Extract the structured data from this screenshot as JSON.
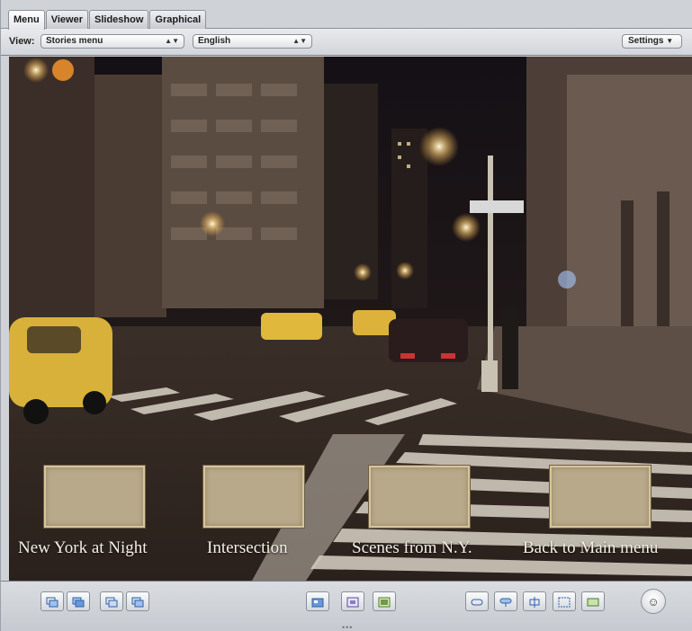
{
  "tabs": [
    {
      "label": "Menu",
      "active": true
    },
    {
      "label": "Viewer",
      "active": false
    },
    {
      "label": "Slideshow",
      "active": false
    },
    {
      "label": "Graphical",
      "active": false
    }
  ],
  "toolbar": {
    "view_label": "View:",
    "view_select": "Stories menu",
    "language_select": "English",
    "settings_label": "Settings"
  },
  "menu": {
    "buttons": [
      {
        "label": "New York at Night"
      },
      {
        "label": "Intersection"
      },
      {
        "label": "Scenes from N.Y."
      },
      {
        "label": "Back to Main menu"
      }
    ],
    "button_color": "#b8a98a",
    "label_color": "#f4f0e6"
  },
  "bottom_toolbar": {
    "icons": [
      "add-submenu-icon",
      "add-submenu-alt-icon",
      "add-text-icon",
      "add-text-alt-icon",
      "add-menu-icon",
      "add-story-icon",
      "add-slideshow-icon",
      "title-safe-icon",
      "route-icon",
      "motion-icon",
      "safe-area-icon",
      "standard-crop-icon",
      "simulator-icon"
    ]
  }
}
